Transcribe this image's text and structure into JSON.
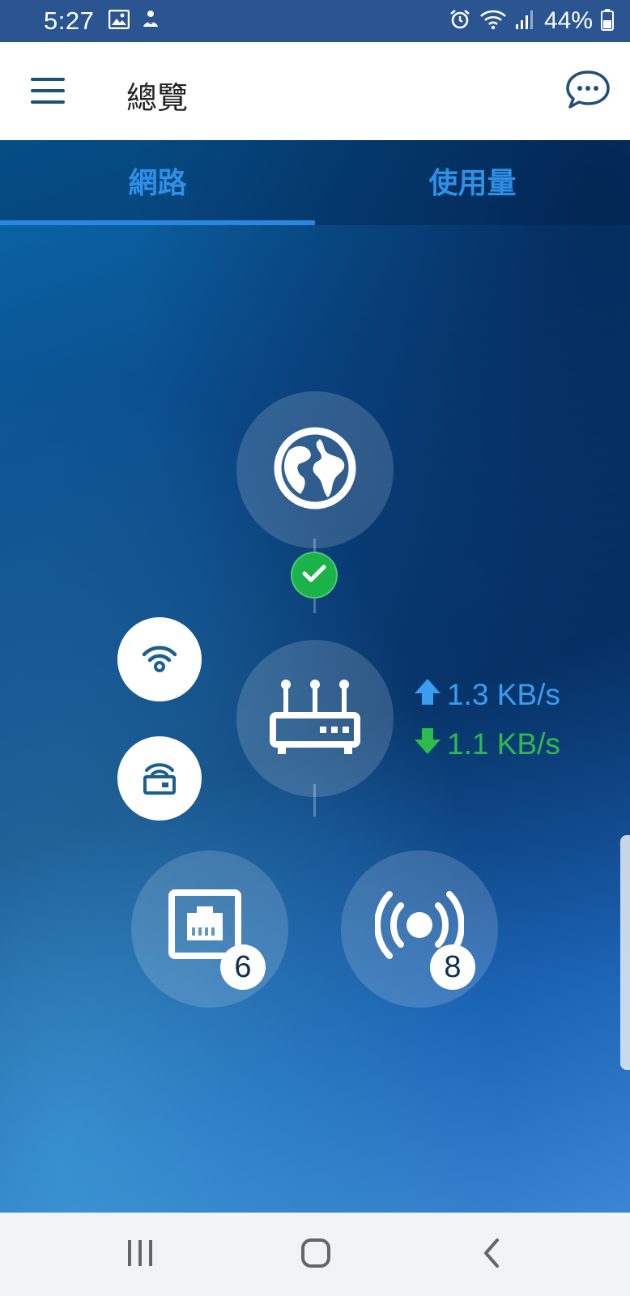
{
  "status_bar": {
    "time": "5:27",
    "battery": "44%"
  },
  "app_bar": {
    "title": "總覽"
  },
  "tabs": [
    {
      "label": "網路",
      "active": true
    },
    {
      "label": "使用量",
      "active": false
    }
  ],
  "topology": {
    "upload_speed": "1.3 KB/s",
    "download_speed": "1.1 KB/s",
    "wired_clients": "6",
    "wireless_clients": "8"
  },
  "colors": {
    "accent": "#2a86e0",
    "upload": "#3b9cf0",
    "download": "#2dbb4c",
    "status_ok": "#19b34a"
  },
  "icons": {
    "internet": "globe-icon",
    "router": "router-icon",
    "wifi": "wifi-icon",
    "guest": "guest-network-icon",
    "ethernet": "ethernet-icon",
    "wireless": "wireless-broadcast-icon"
  }
}
